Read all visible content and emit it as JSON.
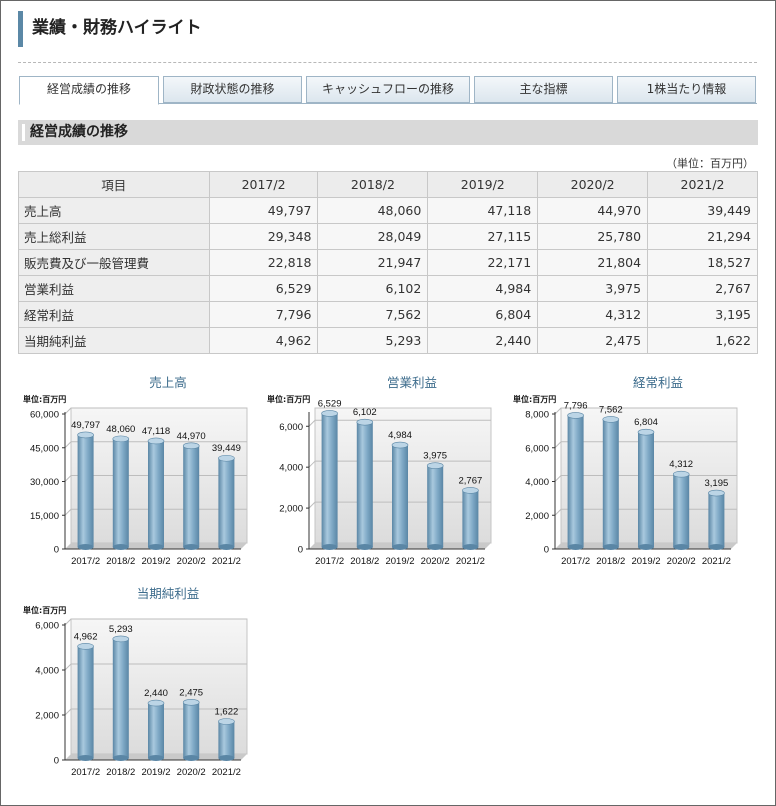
{
  "page_title": "業績・財務ハイライト",
  "tabs": [
    {
      "label": "経営成績の推移",
      "active": true
    },
    {
      "label": "財政状態の推移",
      "active": false
    },
    {
      "label": "キャッシュフローの推移",
      "active": false
    },
    {
      "label": "主な指標",
      "active": false
    },
    {
      "label": "1株当たり情報",
      "active": false
    }
  ],
  "section_title": "経営成績の推移",
  "unit_note": "（単位：百万円）",
  "table": {
    "headers": [
      "項目",
      "2017/2",
      "2018/2",
      "2019/2",
      "2020/2",
      "2021/2"
    ],
    "rows": [
      [
        "売上高",
        "49,797",
        "48,060",
        "47,118",
        "44,970",
        "39,449"
      ],
      [
        "売上総利益",
        "29,348",
        "28,049",
        "27,115",
        "25,780",
        "21,294"
      ],
      [
        "販売費及び一般管理費",
        "22,818",
        "21,947",
        "22,171",
        "21,804",
        "18,527"
      ],
      [
        "営業利益",
        "6,529",
        "6,102",
        "4,984",
        "3,975",
        "2,767"
      ],
      [
        "経常利益",
        "7,796",
        "7,562",
        "6,804",
        "4,312",
        "3,195"
      ],
      [
        "当期純利益",
        "4,962",
        "5,293",
        "2,440",
        "2,475",
        "1,622"
      ]
    ]
  },
  "colors": {
    "bar": "#7fa9c6",
    "bar_dark": "#5a86a5",
    "accent": "#5b88a6",
    "title": "#3d6c8c"
  },
  "chart_data": [
    {
      "type": "bar",
      "title": "売上高",
      "unit_label": "単位:百万円",
      "categories": [
        "2017/2",
        "2018/2",
        "2019/2",
        "2020/2",
        "2021/2"
      ],
      "values": [
        49797,
        48060,
        47118,
        44970,
        39449
      ],
      "value_labels": [
        "49,797",
        "48,060",
        "47,118",
        "44,970",
        "39,449"
      ],
      "yticks": [
        0,
        15000,
        30000,
        45000,
        60000
      ],
      "ytick_labels": [
        "0",
        "15,000",
        "30,000",
        "45,000",
        "60,000"
      ],
      "ylim": [
        0,
        60000
      ],
      "grid": true
    },
    {
      "type": "bar",
      "title": "営業利益",
      "unit_label": "単位:百万円",
      "categories": [
        "2017/2",
        "2018/2",
        "2019/2",
        "2020/2",
        "2021/2"
      ],
      "values": [
        6529,
        6102,
        4984,
        3975,
        2767
      ],
      "value_labels": [
        "6,529",
        "6,102",
        "4,984",
        "3,975",
        "2,767"
      ],
      "yticks": [
        0,
        2000,
        4000,
        6000
      ],
      "ytick_labels": [
        "0",
        "2,000",
        "4,000",
        "6,000"
      ],
      "ylim": [
        0,
        6600
      ],
      "grid": true
    },
    {
      "type": "bar",
      "title": "経常利益",
      "unit_label": "単位:百万円",
      "categories": [
        "2017/2",
        "2018/2",
        "2019/2",
        "2020/2",
        "2021/2"
      ],
      "values": [
        7796,
        7562,
        6804,
        4312,
        3195
      ],
      "value_labels": [
        "7,796",
        "7,562",
        "6,804",
        "4,312",
        "3,195"
      ],
      "yticks": [
        0,
        2000,
        4000,
        6000,
        8000
      ],
      "ytick_labels": [
        "0",
        "2,000",
        "4,000",
        "6,000",
        "8,000"
      ],
      "ylim": [
        0,
        8000
      ],
      "grid": true
    },
    {
      "type": "bar",
      "title": "当期純利益",
      "unit_label": "単位:百万円",
      "categories": [
        "2017/2",
        "2018/2",
        "2019/2",
        "2020/2",
        "2021/2"
      ],
      "values": [
        4962,
        5293,
        2440,
        2475,
        1622
      ],
      "value_labels": [
        "4,962",
        "5,293",
        "2,440",
        "2,475",
        "1,622"
      ],
      "yticks": [
        0,
        2000,
        4000,
        6000
      ],
      "ytick_labels": [
        "0",
        "2,000",
        "4,000",
        "6,000"
      ],
      "ylim": [
        0,
        6000
      ],
      "grid": true
    }
  ]
}
